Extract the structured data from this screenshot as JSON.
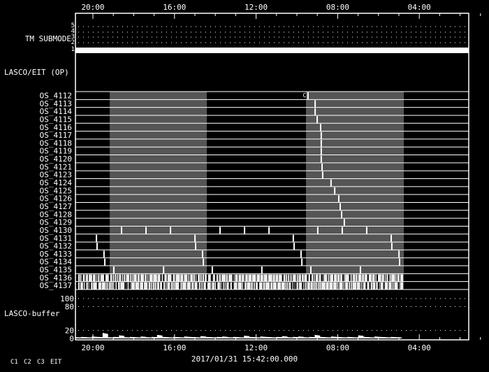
{
  "chart_data": {
    "type": "timeline",
    "time_ticks": [
      "20:00",
      "16:00",
      "12:00",
      "08:00",
      "04:00"
    ],
    "date_label": "2017/01/31 15:42:00.000",
    "tm_submode": {
      "label": "TM SUBMODE",
      "levels": [
        "5",
        "4",
        "3",
        "2",
        "1"
      ],
      "active_level": 1
    },
    "section_label": "LASCO/EIT (OP)",
    "shaded_intervals_hours": [
      [
        1.68,
        6.44
      ],
      [
        11.3,
        16.1
      ]
    ],
    "rows": [
      {
        "name": "OS_4112",
        "markers": [
          11.4
        ],
        "marker_label": "C"
      },
      {
        "name": "OS_4113",
        "markers": [
          11.75
        ]
      },
      {
        "name": "OS_4114",
        "markers": [
          11.75
        ]
      },
      {
        "name": "OS_4115",
        "markers": [
          11.85
        ]
      },
      {
        "name": "OS_4116",
        "markers": [
          12.02
        ]
      },
      {
        "name": "OS_4117",
        "markers": [
          12.05
        ]
      },
      {
        "name": "OS_4118",
        "markers": [
          12.05
        ]
      },
      {
        "name": "OS_4119",
        "markers": [
          12.05
        ]
      },
      {
        "name": "OS_4120",
        "markers": [
          12.05
        ]
      },
      {
        "name": "OS_4121",
        "markers": [
          12.09
        ]
      },
      {
        "name": "OS_4123",
        "markers": [
          12.12
        ]
      },
      {
        "name": "OS_4124",
        "markers": [
          12.53
        ]
      },
      {
        "name": "OS_4125",
        "markers": [
          12.71
        ]
      },
      {
        "name": "OS_4126",
        "markers": [
          12.91
        ]
      },
      {
        "name": "OS_4127",
        "markers": [
          12.98
        ]
      },
      {
        "name": "OS_4128",
        "markers": [
          13.05
        ]
      },
      {
        "name": "OS_4129",
        "markers": [
          13.18
        ]
      },
      {
        "name": "OS_4130",
        "markers": [
          2.26,
          3.46,
          4.66,
          7.09,
          8.29,
          9.49,
          11.88,
          13.08,
          14.28
        ]
      },
      {
        "name": "OS_4131",
        "markers": [
          1.03,
          5.86,
          10.68,
          15.48
        ]
      },
      {
        "name": "OS_4132",
        "markers": [
          1.06,
          5.89,
          10.72,
          15.51
        ]
      },
      {
        "name": "OS_4133",
        "markers": [
          1.4,
          6.23,
          11.06,
          15.86
        ]
      },
      {
        "name": "OS_4134",
        "markers": [
          1.44,
          6.27,
          11.1,
          15.89
        ]
      },
      {
        "name": "OS_4135",
        "markers": [
          1.88,
          4.32,
          6.71,
          9.14,
          11.54,
          13.97
        ]
      },
      {
        "name": "OS_4136",
        "markers": [],
        "dense": true
      },
      {
        "name": "OS_4137",
        "markers": [],
        "dense": true
      }
    ],
    "buffer": {
      "label": "LASCO-buffer",
      "yticks": [
        "100",
        "80",
        "20",
        "0"
      ],
      "ylim": [
        0,
        100
      ],
      "values": [
        3,
        4,
        3,
        5,
        4,
        14,
        3,
        4,
        8,
        3,
        4,
        3,
        5,
        3,
        4,
        9,
        4,
        3,
        4,
        3,
        5,
        4,
        3,
        6,
        4,
        3,
        4,
        5,
        3,
        4,
        3,
        7,
        4,
        3,
        5,
        4,
        3,
        4,
        6,
        3,
        4,
        5,
        3,
        4,
        9,
        4,
        3,
        5,
        4,
        3,
        4,
        3,
        8,
        4,
        3,
        5,
        4,
        3,
        4,
        3
      ]
    },
    "legend": [
      "C1",
      "C2",
      "C3",
      "EIT"
    ]
  }
}
